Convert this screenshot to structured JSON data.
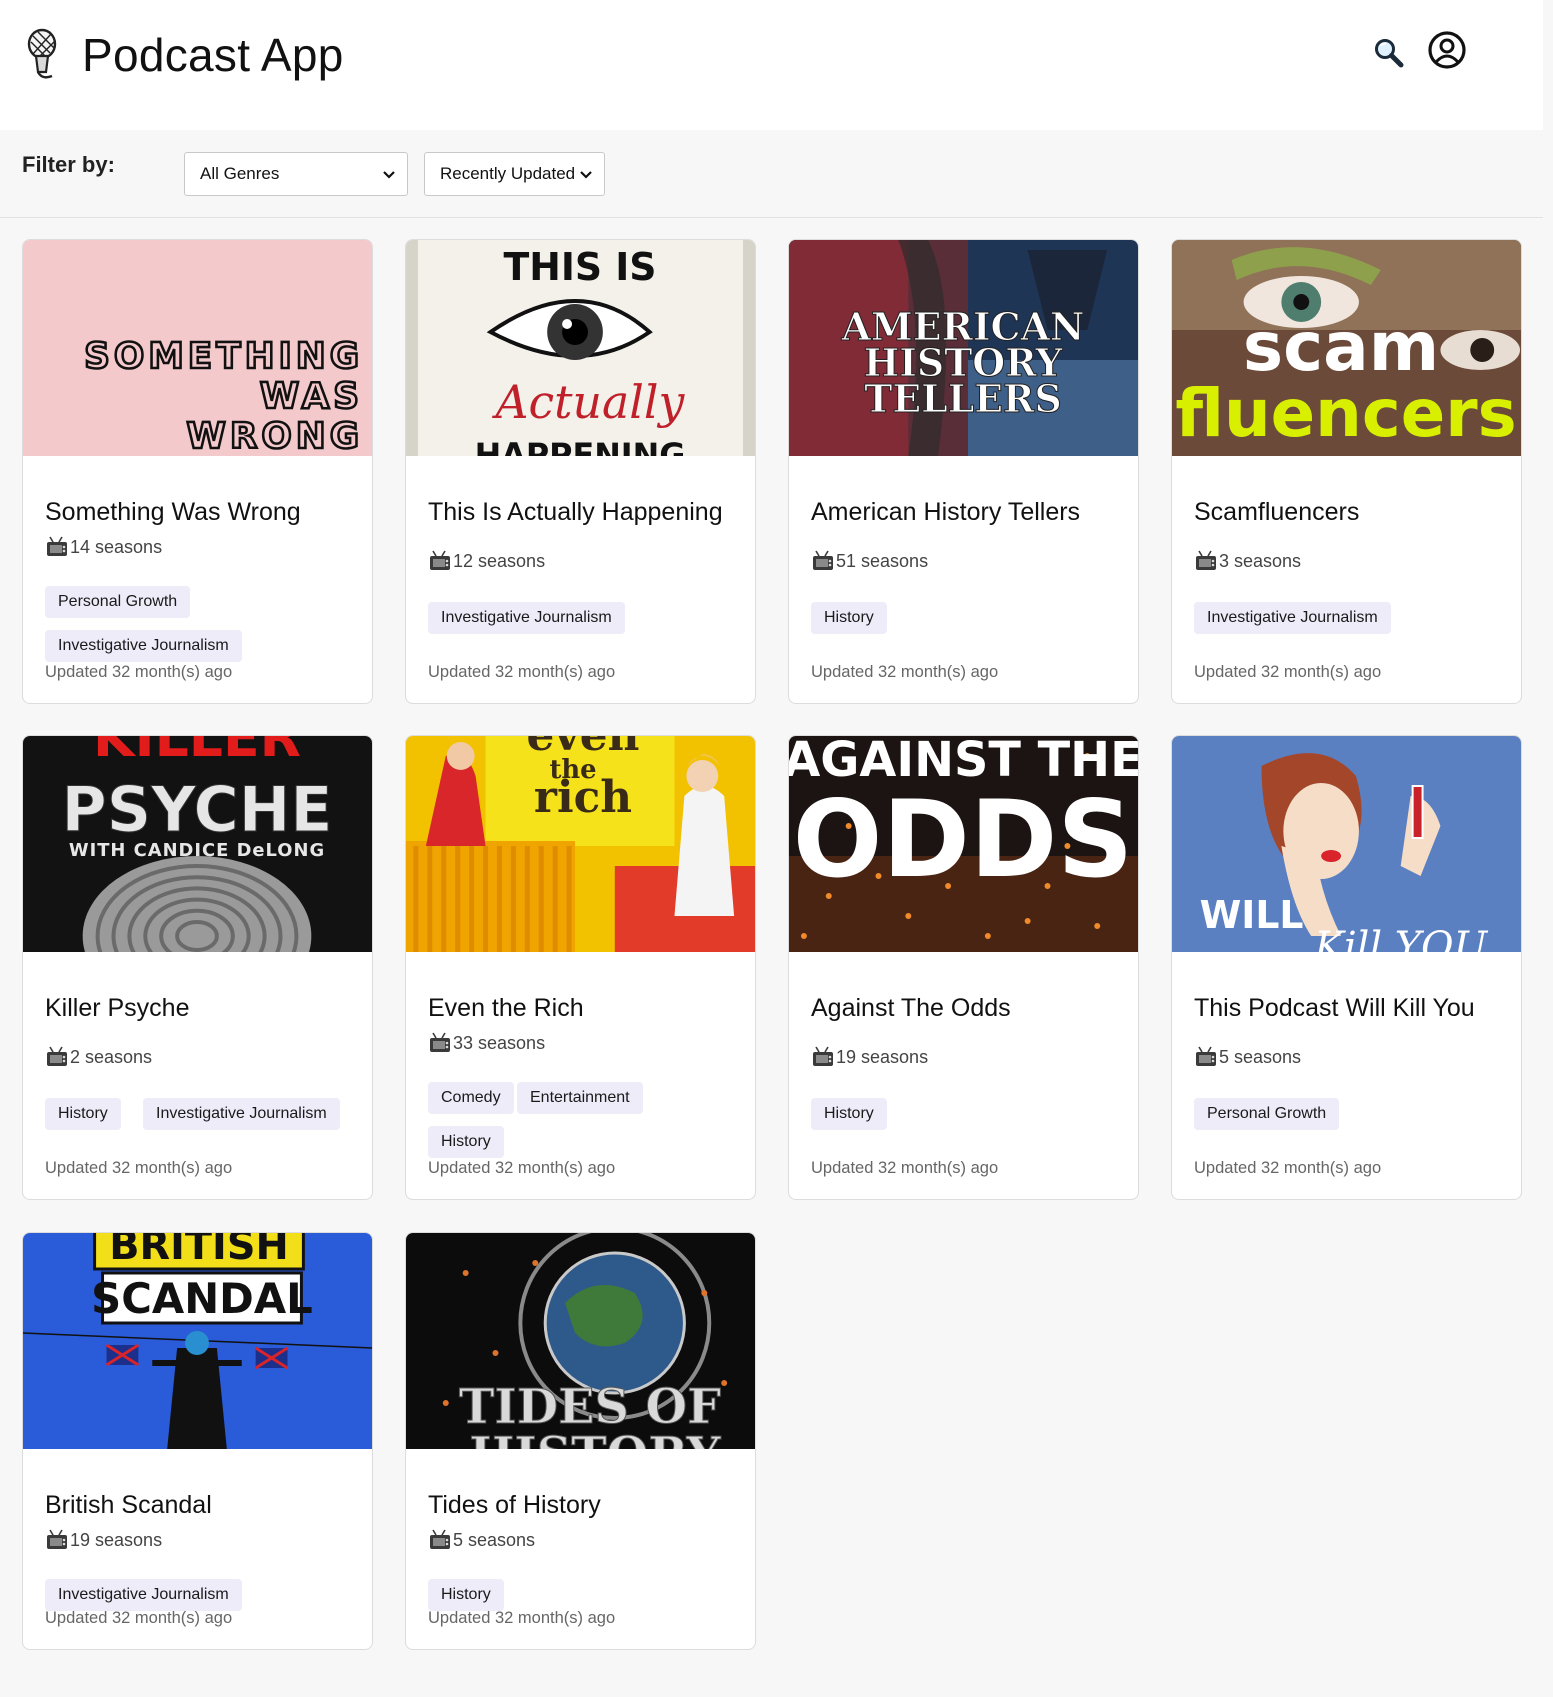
{
  "app": {
    "title": "Podcast App",
    "logo_icon": "microphone-icon"
  },
  "header": {
    "search_icon": "search-icon",
    "account_icon": "user-circle-icon"
  },
  "filters": {
    "label": "Filter by:",
    "genre_selected": "All Genres",
    "sort_selected": "Recently Updated"
  },
  "podcasts": [
    {
      "title": "Something Was Wrong",
      "seasons": "14 seasons",
      "genres": [
        "Personal Growth",
        "Investigative Journalism"
      ],
      "updated": "Updated 32 month(s) ago",
      "cover_text": [
        "SOMETHING",
        "WAS",
        "WRONG"
      ]
    },
    {
      "title": "This Is Actually Happening",
      "seasons": "12 seasons",
      "genres": [
        "Investigative Journalism"
      ],
      "updated": "Updated 32 month(s) ago",
      "cover_text": [
        "THIS IS",
        "Actually",
        "HAPPENING"
      ]
    },
    {
      "title": "American History Tellers",
      "seasons": "51 seasons",
      "genres": [
        "History"
      ],
      "updated": "Updated 32 month(s) ago",
      "cover_text": [
        "AMERICAN",
        "HISTORY",
        "TELLERS"
      ]
    },
    {
      "title": "Scamfluencers",
      "seasons": "3 seasons",
      "genres": [
        "Investigative Journalism"
      ],
      "updated": "Updated 32 month(s) ago",
      "cover_text": [
        "scam",
        "fluencers"
      ]
    },
    {
      "title": "Killer Psyche",
      "seasons": "2 seasons",
      "genres": [
        "History",
        "Investigative Journalism"
      ],
      "updated": "Updated 32 month(s) ago",
      "cover_text": [
        "KILLER",
        "PSYCHE",
        "WITH CANDICE DeLONG"
      ]
    },
    {
      "title": "Even the Rich",
      "seasons": "33 seasons",
      "genres": [
        "Comedy",
        "Entertainment",
        "History"
      ],
      "updated": "Updated 32 month(s) ago",
      "cover_text": [
        "even",
        "the",
        "rich"
      ]
    },
    {
      "title": "Against The Odds",
      "seasons": "19 seasons",
      "genres": [
        "History"
      ],
      "updated": "Updated 32 month(s) ago",
      "cover_text": [
        "AGAINST THE",
        "ODDS"
      ]
    },
    {
      "title": "This Podcast Will Kill You",
      "seasons": "5 seasons",
      "genres": [
        "Personal Growth"
      ],
      "updated": "Updated 32 month(s) ago",
      "cover_text": [
        "WILL",
        "Kill YOU"
      ]
    },
    {
      "title": "British Scandal",
      "seasons": "19 seasons",
      "genres": [
        "Investigative Journalism"
      ],
      "updated": "Updated 32 month(s) ago",
      "cover_text": [
        "BRITISH",
        "SCANDAL"
      ]
    },
    {
      "title": "Tides of History",
      "seasons": "5 seasons",
      "genres": [
        "History"
      ],
      "updated": "Updated 32 month(s) ago",
      "cover_text": [
        "TIDES OF",
        "HISTORY"
      ]
    }
  ]
}
